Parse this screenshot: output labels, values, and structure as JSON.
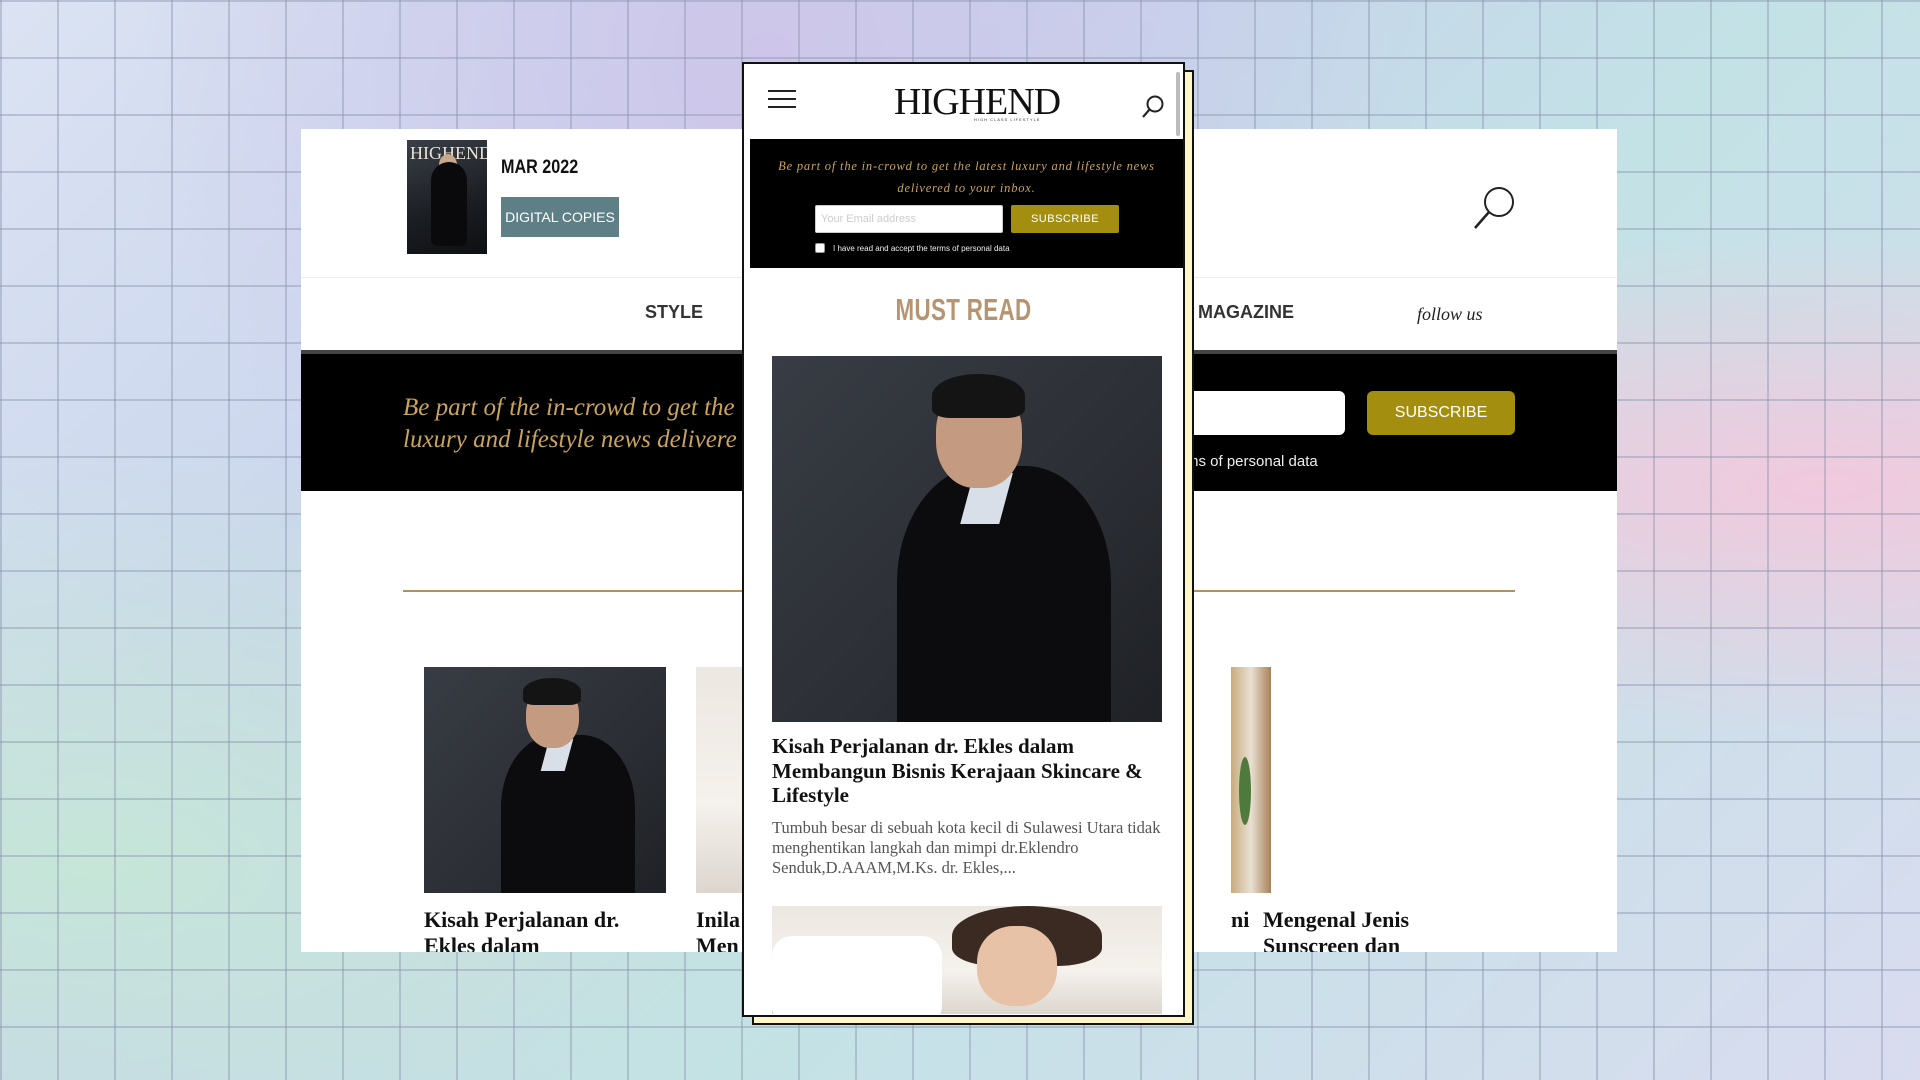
{
  "desktop": {
    "issue": "MAR 2022",
    "digital_button": "DIGITAL COPIES",
    "cover_logo": "HIGHEND",
    "nav": {
      "style": "STYLE",
      "magazine": "MAGAZINE",
      "follow": "follow us"
    },
    "banner": {
      "line1": "Be part of the in-crowd to get the",
      "line2": "luxury and lifestyle news delivere",
      "subscribe": "SUBSCRIBE",
      "terms_fragment": "ms of personal data"
    },
    "cards": [
      {
        "title_line1": "Kisah Perjalanan dr.",
        "title_line2": "Ekles dalam"
      },
      {
        "title_line1": "Inila",
        "title_line2": "Men"
      },
      {
        "title_line1": "ni",
        "title_line2": ""
      },
      {
        "title_line1": "Mengenal Jenis",
        "title_line2": "Sunscreen dan"
      }
    ]
  },
  "mobile": {
    "logo": "HIGHEND",
    "logo_sub": "HIGH CLASS LIFESTYLE",
    "banner_text": "Be part of the in-crowd to get the latest luxury and lifestyle news delivered to your inbox.",
    "email_placeholder": "Your Email address",
    "subscribe": "SUBSCRIBE",
    "terms": "I have read and accept the terms of personal data",
    "section_title": "MUST READ",
    "article": {
      "title": "Kisah Perjalanan dr. Ekles dalam Membangun Bisnis Kerajaan Skincare & Lifestyle",
      "excerpt": "Tumbuh besar di sebuah kota kecil di Sulawesi Utara tidak menghentikan langkah dan mimpi dr.Eklendro Senduk,D.AAAM,M.Ks. dr. Ekles,..."
    }
  },
  "colors": {
    "gold_text": "#c9a45a",
    "subscribe_bg": "#a38e10",
    "must_read": "#b69470",
    "digital_button_bg": "#5f7f86"
  },
  "icons": {
    "menu": "hamburger-icon",
    "search": "search-icon",
    "checkbox": "checkbox-icon"
  }
}
